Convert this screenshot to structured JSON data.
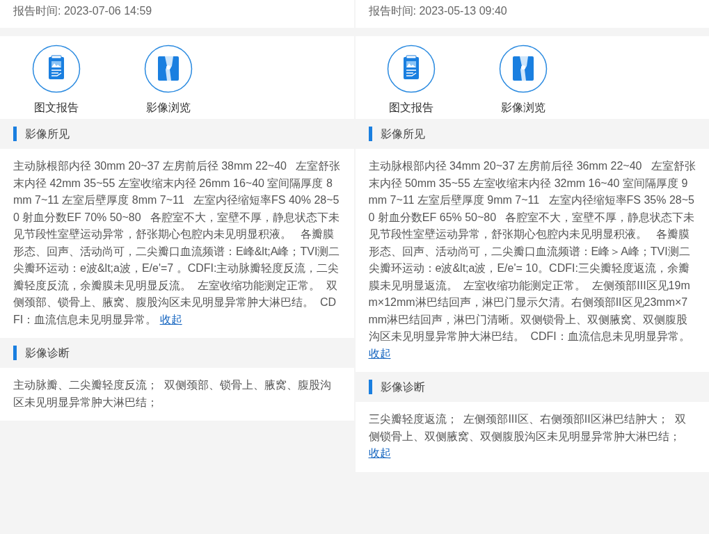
{
  "reports": [
    {
      "time_label": "报告时间: 2023-07-06 14:59",
      "actions": [
        {
          "kind": "report",
          "label": "图文报告"
        },
        {
          "kind": "image",
          "label": "影像浏览"
        }
      ],
      "sections": [
        {
          "title": "影像所见",
          "text": "主动脉根部内径 30mm 20~37 左房前后径 38mm 22~40   左室舒张末内径 42mm 35~55 左室收缩末内径 26mm 16~40 室间隔厚度 8mm 7~11 左室后壁厚度 8mm 7~11   左室内径缩短率FS 40% 28~50 射血分数EF 70% 50~80   各腔室不大，室壁不厚，静息状态下未见节段性室壁运动异常，舒张期心包腔内未见明显积液。   各瓣膜形态、回声、活动尚可，二尖瓣口血流频谱：E峰&lt;A峰；TVI测二尖瓣环运动：e波&lt;a波，E/e'=7 。CDFI:主动脉瓣轻度反流，二尖瓣轻度反流，余瓣膜未见明显反流。  左室收缩功能测定正常。  双侧颈部、锁骨上、腋窝、腹股沟区未见明显异常肿大淋巴结。  CDFI：血流信息未见明显异常。",
          "link": "收起"
        },
        {
          "title": "影像诊断",
          "text": "主动脉瓣、二尖瓣轻度反流；  双侧颈部、锁骨上、腋窝、腹股沟区未见明显异常肿大淋巴结；"
        }
      ]
    },
    {
      "time_label": "报告时间: 2023-05-13 09:40",
      "actions": [
        {
          "kind": "report",
          "label": "图文报告"
        },
        {
          "kind": "image",
          "label": "影像浏览"
        }
      ],
      "sections": [
        {
          "title": "影像所见",
          "text": "主动脉根部内径 34mm 20~37 左房前后径 36mm 22~40   左室舒张末内径 50mm 35~55 左室收缩末内径 32mm 16~40 室间隔厚度 9mm 7~11 左室后壁厚度 9mm 7~11   左室内径缩短率FS 35% 28~50 射血分数EF 65% 50~80   各腔室不大，室壁不厚，静息状态下未见节段性室壁运动异常，舒张期心包腔内未见明显积液。   各瓣膜形态、回声、活动尚可，二尖瓣口血流频谱：E峰＞A峰；TVI测二尖瓣环运动：e波&lt;a波，E/e'= 10。CDFI:三尖瓣轻度返流，余瓣膜未见明显返流。  左室收缩功能测定正常。  左侧颈部III区见19mm×12mm淋巴结回声，淋巴门显示欠清。右侧颈部II区见23mm×7mm淋巴结回声，淋巴门清晰。双侧锁骨上、双侧腋窝、双侧腹股沟区未见明显异常肿大淋巴结。  CDFI：血流信息未见明显异常。",
          "link": "收起"
        },
        {
          "title": "影像诊断",
          "text": "三尖瓣轻度返流；  左侧颈部III区、右侧颈部II区淋巴结肿大；  双侧锁骨上、双侧腋窝、双侧腹股沟区未见明显异常肿大淋巴结；",
          "link": "收起"
        }
      ]
    }
  ]
}
